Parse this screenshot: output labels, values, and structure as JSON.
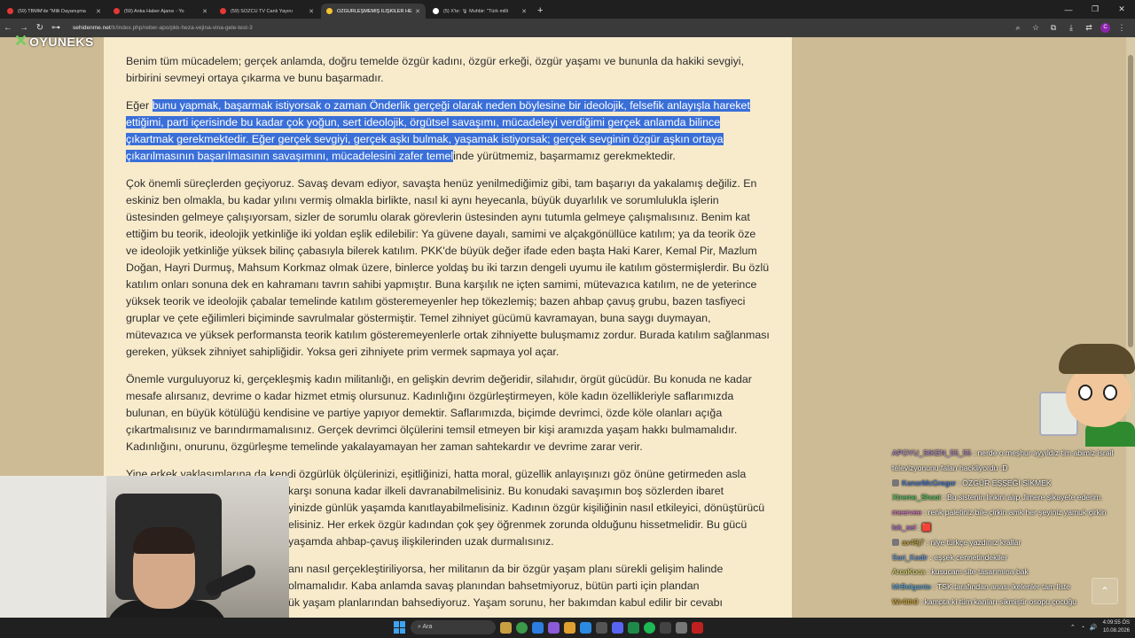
{
  "browser": {
    "tabs": [
      {
        "label": "(59) TBMM'de \"Milli Dayanışma",
        "icon": "youtube-icon",
        "active": false
      },
      {
        "label": "(59) Anka Haber Ajansı - Yo",
        "icon": "youtube-icon",
        "active": false
      },
      {
        "label": "(59) SÖZCÜ TV Canlı Yayını",
        "icon": "youtube-icon",
        "active": false
      },
      {
        "label": "ÖZGÜRLEŞMEMİŞ İLİŞKİLER HE",
        "icon": "site-icon",
        "active": true
      },
      {
        "label": "(5) X'te: 🎙 Muhbir: \"Türk milli",
        "icon": "x-icon",
        "active": false
      }
    ],
    "new_tab": "+",
    "url_host": "sehidenme.net",
    "url_path": "/tr/index.php/reber-apo/pkk-heza-vejina-vina-gele-test-3"
  },
  "site": {
    "logo_text": "OYUNEKS"
  },
  "article": {
    "p1": "Benim tüm mücadelem; gerçek anlamda, doğru temelde özgür kadını, özgür erkeği, özgür yaşamı ve bununla da hakiki sevgiyi, birbirini sevmeyi ortaya çıkarma ve bunu başarmadır.",
    "p2_before": "Eğer ",
    "p2_highlight": "bunu yapmak, başarmak istiyorsak o zaman Önderlik gerçeği olarak neden böylesine bir ideolojik, felsefik anlayışla hareket ettiğimi, parti içerisinde bu kadar çok yoğun, sert ideolojik, örgütsel savaşımı, mücadeleyi verdiğimi gerçek anlamda bilince çıkartmak gerekmektedir. Eğer gerçek sevgiyi, gerçek aşkı bulmak, yaşamak istiyorsak; gerçek sevginin özgür aşkın ortaya çıkarılmasının başarılmasının savaşımını, mücadelesini zafer temel",
    "p2_after": "inde yürütmemiz, başarmamız gerekmektedir.",
    "p3": "Çok önemli süreçlerden geçiyoruz. Savaş devam ediyor, savaşta henüz yenilmediğimiz gibi, tam başarıyı da yakalamış değiliz. En eskiniz ben olmakla, bu kadar yılını vermiş olmakla birlikte, nasıl ki aynı heyecanla, büyük duyarlılık ve sorumlulukla işlerin üstesinden gelmeye çalışıyorsam, sizler de sorumlu olarak görevlerin üstesinden aynı tutumla gelmeye çalışmalısınız. Benim kat ettiğim bu teorik, ideolojik yetkinliğe iki yoldan eşlik edilebilir: Ya güvene dayalı, samimi ve alçakgönüllüce katılım; ya da teorik öze ve ideolojik yetkinliğe yüksek bilinç çabasıyla bilerek katılım. PKK'de büyük değer ifade eden başta Haki Karer, Kemal Pir, Mazlum Doğan, Hayri Durmuş, Mahsum Korkmaz olmak üzere, binlerce yoldaş bu iki tarzın dengeli uyumu ile katılım göstermişlerdir. Bu özlü katılım onları sonuna dek en kahramanı tavrın sahibi yapmıştır. Buna karşılık ne içten samimi, mütevazıca katılım, ne de yeterince yüksek teorik ve ideolojik çabalar temelinde katılım gösteremeyenler hep tökezlemiş; bazen ahbap çavuş grubu, bazen tasfiyeci gruplar ve çete eğilimleri biçiminde savrulmalar göstermiştir. Temel zihniyet gücümü kavramayan, buna saygı duymayan, mütevazıca ve yüksek performansta teorik katılım gösteremeyenlerle ortak zihniyette buluşmamız zordur. Burada katılım sağlanması gereken, yüksek zihniyet sahipliğidir. Yoksa geri zihniyete prim vermek sapmaya yol açar.",
    "p4": "Önemle vurguluyoruz ki, gerçekleşmiş kadın militanlığı, en gelişkin devrim değeridir, silahıdır, örgüt gücüdür. Bu konuda ne kadar mesafe alırsanız, devrime o kadar hizmet etmiş olursunuz. Kadınlığını özgürleştirmeyen, köle kadın özellikleriyle saflarımızda bulunan, en büyük kötülüğü kendisine ve partiye yapıyor demektir. Saflarımızda, biçimde devrimci, özde köle olanları açığa çıkartmalısınız ve barındırmamalısınız. Gerçek devrimci ölçülerini temsil etmeyen bir kişi aramızda yaşam hakkı bulmamalıdır. Kadınlığını, onurunu, özgürleşme temelinde yakalayamayan her zaman sahtekardır ve devrime zarar verir.",
    "p5_l1": "Yine erkek yaklaşımlarına da kendi özgürlük ölçülerinizi, eşitliğinizi, hatta moral, güzellik anlayışınızı göz önüne getirmeden asla",
    "p5_l2": "karşı sonuna kadar ilkeli davranabilmelisiniz. Bu konudaki savaşımın boş sözlerden ibaret",
    "p5_l3": "yinizde günlük yaşamda kanıtlayabilmelisiniz. Kadının özgür kişiliğinin nasıl etkileyici, dönüştürücü",
    "p5_l4": "elisiniz. Her erkek özgür kadından çok şey öğrenmek zorunda olduğunu hissetmelidir. Bu gücü",
    "p5_l5": "yaşamda ahbap-çavuş ilişkilerinden uzak durmalısınız.",
    "p6_l1": "anı nasıl gerçekleştiriliyorsa, her militanın da bir özgür yaşam planı sürekli gelişim halinde",
    "p6_l2": "olmamalıdır. Kaba anlamda savaş planından bahsetmiyoruz, bütün parti için plandan",
    "p6_l3": "ük yaşam planlarından bahsediyoruz. Yaşam sorunu, her bakımdan kabul edilir bir cevabı"
  },
  "chat": [
    {
      "user": "APOYU_SIKEN_55_55",
      "user_color": "#b48ad8",
      "text": ": nerde o meşhur ayyıldız tim abimiz israil televizyonunu falan hackliyordu :D"
    },
    {
      "user": "KonorMcGregor",
      "user_color": "#3a7bf0",
      "text": ": ÖZGÜR EŞŞEĞİ SİKMEK",
      "badge": true
    },
    {
      "user": "Xtreme_Shoot",
      "user_color": "#4fd36a",
      "text": ": Bu sistenin linkini alıp Jimere şikayete ederim."
    },
    {
      "user": "meervee",
      "user_color": "#e07ad8",
      "text": ": renk paletiniz bile çirkin amk her şeyiniz yamuk çirkin"
    },
    {
      "user": "lok_sel",
      "user_color": "#c070e0",
      "text": ": 🟥"
    },
    {
      "user": "ax49j7",
      "user_color": "#c8b040",
      "text": ": niye türkçe yazdınız krallar",
      "badge": true
    },
    {
      "user": "Sari_Kadir",
      "user_color": "#6aa0f0",
      "text": ": eşşek cennetindekiler"
    },
    {
      "user": "ArcaKoca",
      "user_color": "#e0e070",
      "text": ": kusucam site tasarımına bak"
    },
    {
      "user": "MrBelgante",
      "user_color": "#5ab0f0",
      "text": ": TSK tarafından anası ikelenler tam liste"
    },
    {
      "user": "Wr4ith0",
      "user_color": "#e0b030",
      "text": ": kampta ki tüm karıları sikmiştir osopu çocuğu"
    }
  ],
  "scroll_top": "⌃",
  "taskbar": {
    "search": "Ara",
    "time": "4:09:55 ÖS",
    "date": "10.08.2026"
  }
}
